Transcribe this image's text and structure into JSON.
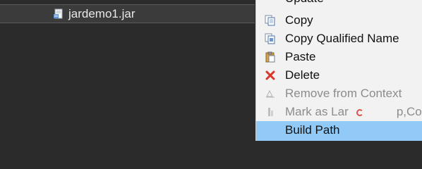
{
  "explorer": {
    "selected_item": {
      "label": "jardemo1.jar",
      "icon": "jar-file-icon"
    }
  },
  "context_menu": {
    "top_partial_label": "Update",
    "items": [
      {
        "label": "Copy",
        "icon": "copy-icon",
        "enabled": true
      },
      {
        "label": "Copy Qualified Name",
        "icon": "copy-qualified-name-icon",
        "enabled": true
      },
      {
        "label": "Paste",
        "icon": "paste-icon",
        "enabled": true
      },
      {
        "label": "Delete",
        "icon": "delete-icon",
        "enabled": true
      },
      {
        "label": "Remove from Context",
        "icon": "remove-from-context-icon",
        "enabled": false
      },
      {
        "label": "Mark as Lar",
        "label_suffix": "                    p,Cor",
        "icon": "mark-icon",
        "enabled": false
      },
      {
        "label": "Build Path",
        "icon": "",
        "enabled": true,
        "highlighted": true
      }
    ]
  },
  "colors": {
    "explorer_bg": "#2b2b2b",
    "selected_row_bg": "#3b3b3b",
    "menu_bg": "#f2f2f2",
    "highlight": "#91c9f7",
    "disabled_text": "#8c8c8c",
    "delete_red": "#d9362b"
  }
}
